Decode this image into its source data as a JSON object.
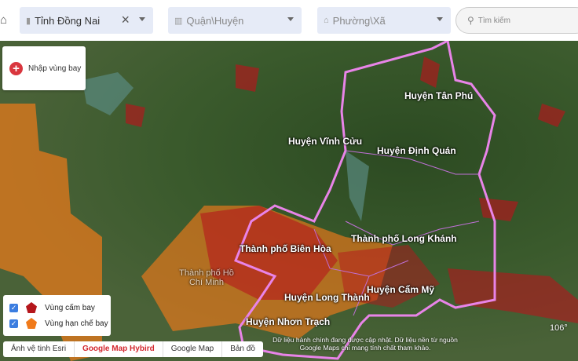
{
  "filters": {
    "province": {
      "value": "Tỉnh Đồng Nai",
      "icon": "building-icon"
    },
    "district": {
      "placeholder": "Quận\\Huyện",
      "icon": "bank-icon"
    },
    "ward": {
      "placeholder": "Phường\\Xã",
      "icon": "home-icon"
    },
    "search": {
      "placeholder": "Tìm kiếm",
      "icon": "search-icon"
    }
  },
  "add_zone": {
    "label": "Nhập vùng bay"
  },
  "legend": [
    {
      "label": "Vùng cấm bay",
      "color": "#b5161c"
    },
    {
      "label": "Vùng hạn chế bay",
      "color": "#f07a1a"
    }
  ],
  "basemaps": [
    {
      "label": "Ảnh vệ tinh Esri"
    },
    {
      "label": "Google Map Hybird",
      "active": true
    },
    {
      "label": "Google Map"
    },
    {
      "label": "Bản đồ"
    }
  ],
  "notice": "Dữ liệu hành chính đang được cập nhật. Dữ liệu nền từ nguồn Google Maps chỉ mang tính chất tham khảo.",
  "coordinate": "106°",
  "districts": [
    "Huyện Tân Phú",
    "Huyện Vĩnh Cửu",
    "Huyện Định Quán",
    "Thành phố Biên Hòa",
    "Thành phố Long Khánh",
    "Huyện Long Thành",
    "Huyện Cẩm Mỹ",
    "Huyện Nhơn Trạch"
  ],
  "map_places": [
    "Thành phố Hồ Chí Minh"
  ]
}
